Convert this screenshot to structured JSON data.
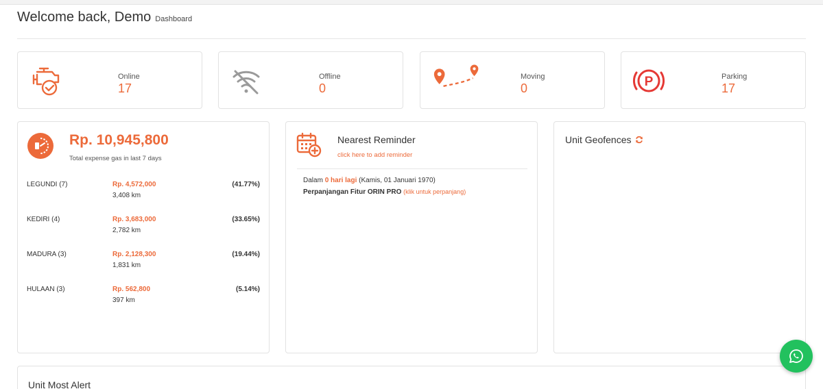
{
  "header": {
    "title": "Welcome back, Demo",
    "breadcrumb": "Dashboard"
  },
  "stats": [
    {
      "label": "Online",
      "value": "17",
      "icon": "engine-check-icon"
    },
    {
      "label": "Offline",
      "value": "0",
      "icon": "wifi-off-icon"
    },
    {
      "label": "Moving",
      "value": "0",
      "icon": "route-pins-icon"
    },
    {
      "label": "Parking",
      "value": "17",
      "icon": "parking-icon"
    }
  ],
  "gas": {
    "total": "Rp. 10,945,800",
    "subtitle": "Total expense gas in last 7 days",
    "rows": [
      {
        "name": "LEGUNDI (7)",
        "amount": "Rp. 4,572,000",
        "km": "3,408 km",
        "percent": "(41.77%)"
      },
      {
        "name": "KEDIRI (4)",
        "amount": "Rp. 3,683,000",
        "km": "2,782 km",
        "percent": "(33.65%)"
      },
      {
        "name": "MADURA (3)",
        "amount": "Rp. 2,128,300",
        "km": "1,831 km",
        "percent": "(19.44%)"
      },
      {
        "name": "HULAAN (3)",
        "amount": "Rp. 562,800",
        "km": "397 km",
        "percent": "(5.14%)"
      }
    ]
  },
  "reminder": {
    "title": "Nearest Reminder",
    "add_link": "click here to add reminder",
    "prefix": "Dalam",
    "days": "0 hari lagi",
    "date": "(Kamis, 01 Januari 1970)",
    "item": "Perpanjangan Fitur ORIN PRO",
    "item_link": "(klik untuk perpanjang)"
  },
  "geofence": {
    "title": "Unit Geofences"
  },
  "alert": {
    "title": "Unit Most Alert"
  },
  "colors": {
    "accent": "#ec6a3a",
    "whatsapp": "#22c15e"
  }
}
